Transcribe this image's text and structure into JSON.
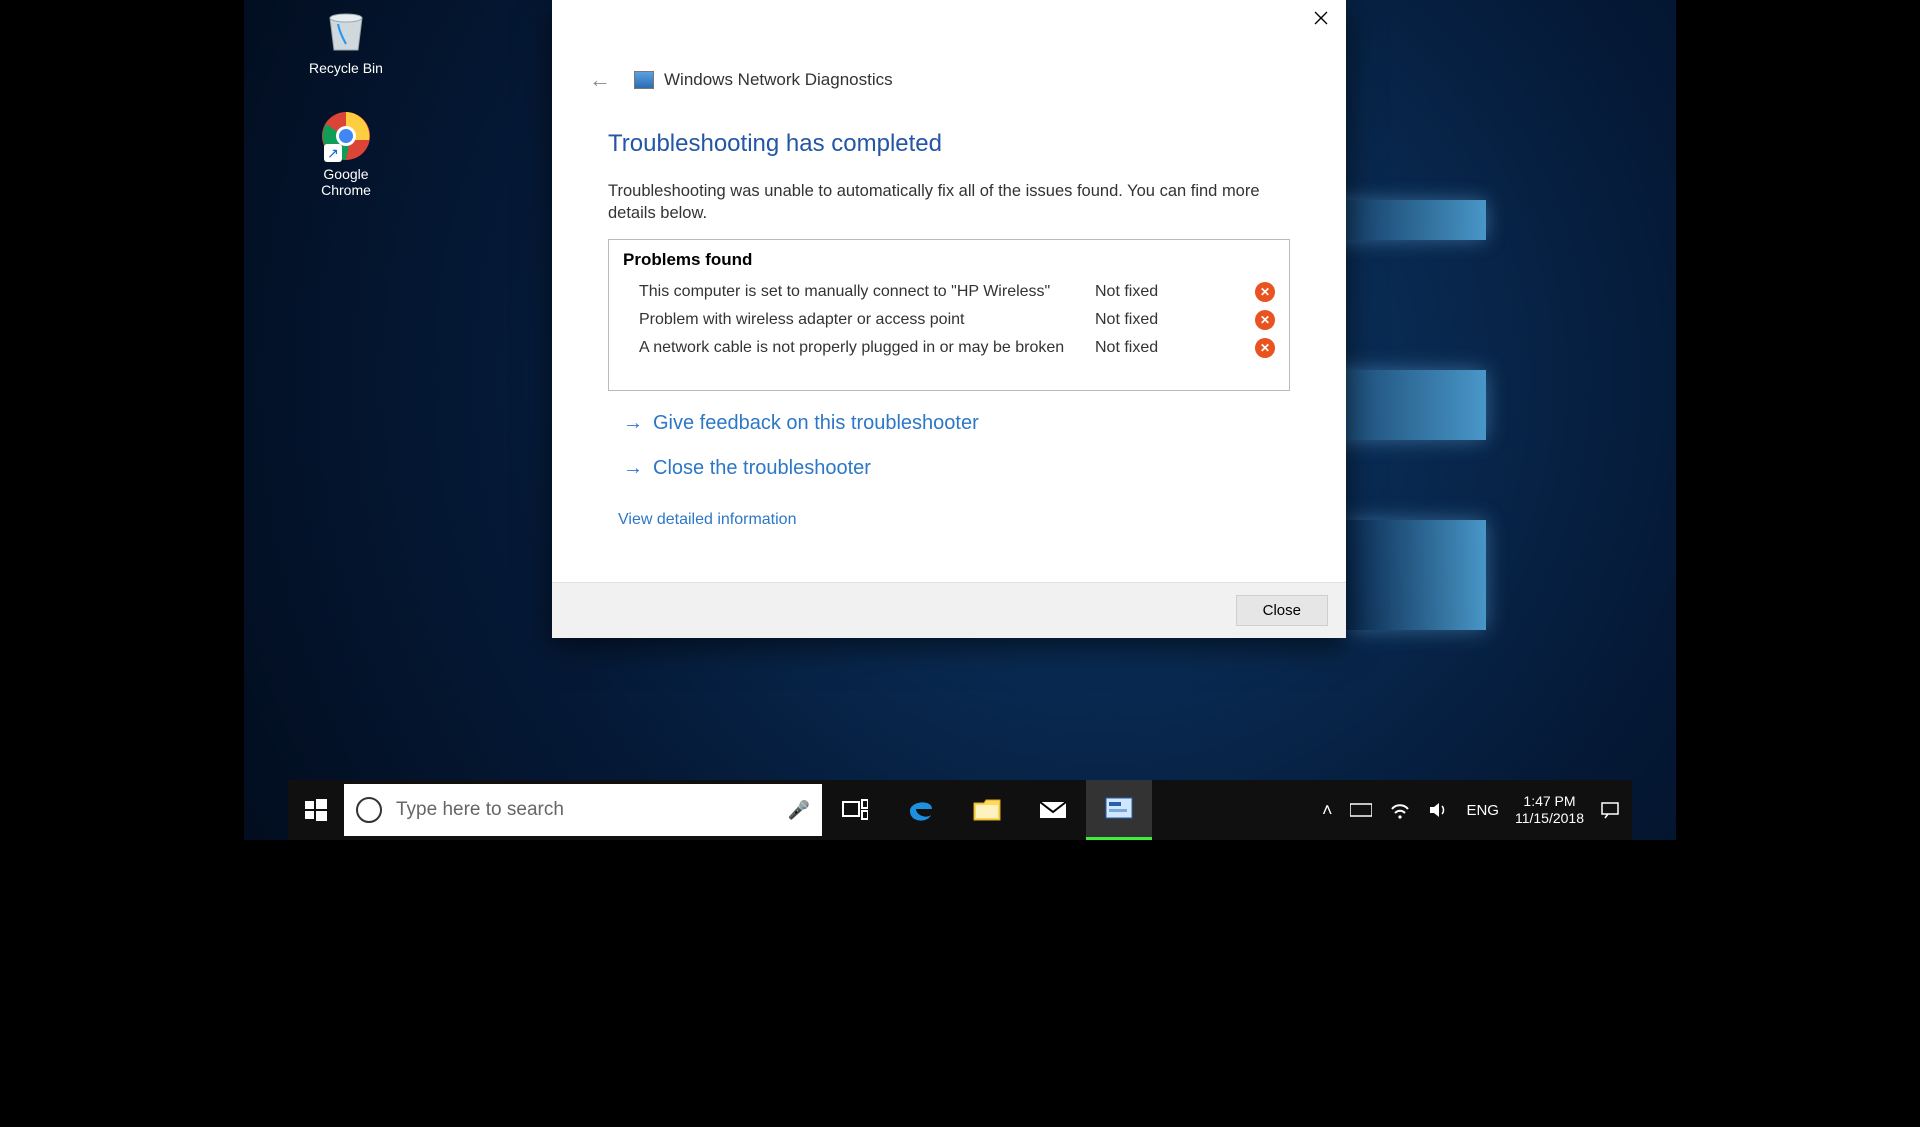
{
  "desktop": {
    "icons": [
      {
        "name": "recycle-bin",
        "label": "Recycle Bin"
      },
      {
        "name": "google-chrome",
        "label": "Google\nChrome"
      }
    ]
  },
  "dialog": {
    "app_title": "Windows Network Diagnostics",
    "heading": "Troubleshooting has completed",
    "description": "Troubleshooting was unable to automatically fix all of the issues found. You can find more details below.",
    "problems_header": "Problems found",
    "problems": [
      {
        "desc": "This computer is set to manually connect to \"HP Wireless\"",
        "status": "Not fixed"
      },
      {
        "desc": "Problem with wireless adapter or access point",
        "status": "Not fixed"
      },
      {
        "desc": "A network cable is not properly plugged in or may be broken",
        "status": "Not fixed"
      }
    ],
    "actions": {
      "feedback": "Give feedback on this troubleshooter",
      "close_troubleshooter": "Close the troubleshooter"
    },
    "detail_link": "View detailed information",
    "footer_close": "Close"
  },
  "taskbar": {
    "search_placeholder": "Type here to search",
    "language": "ENG",
    "time": "1:47 PM",
    "date": "11/15/2018"
  }
}
